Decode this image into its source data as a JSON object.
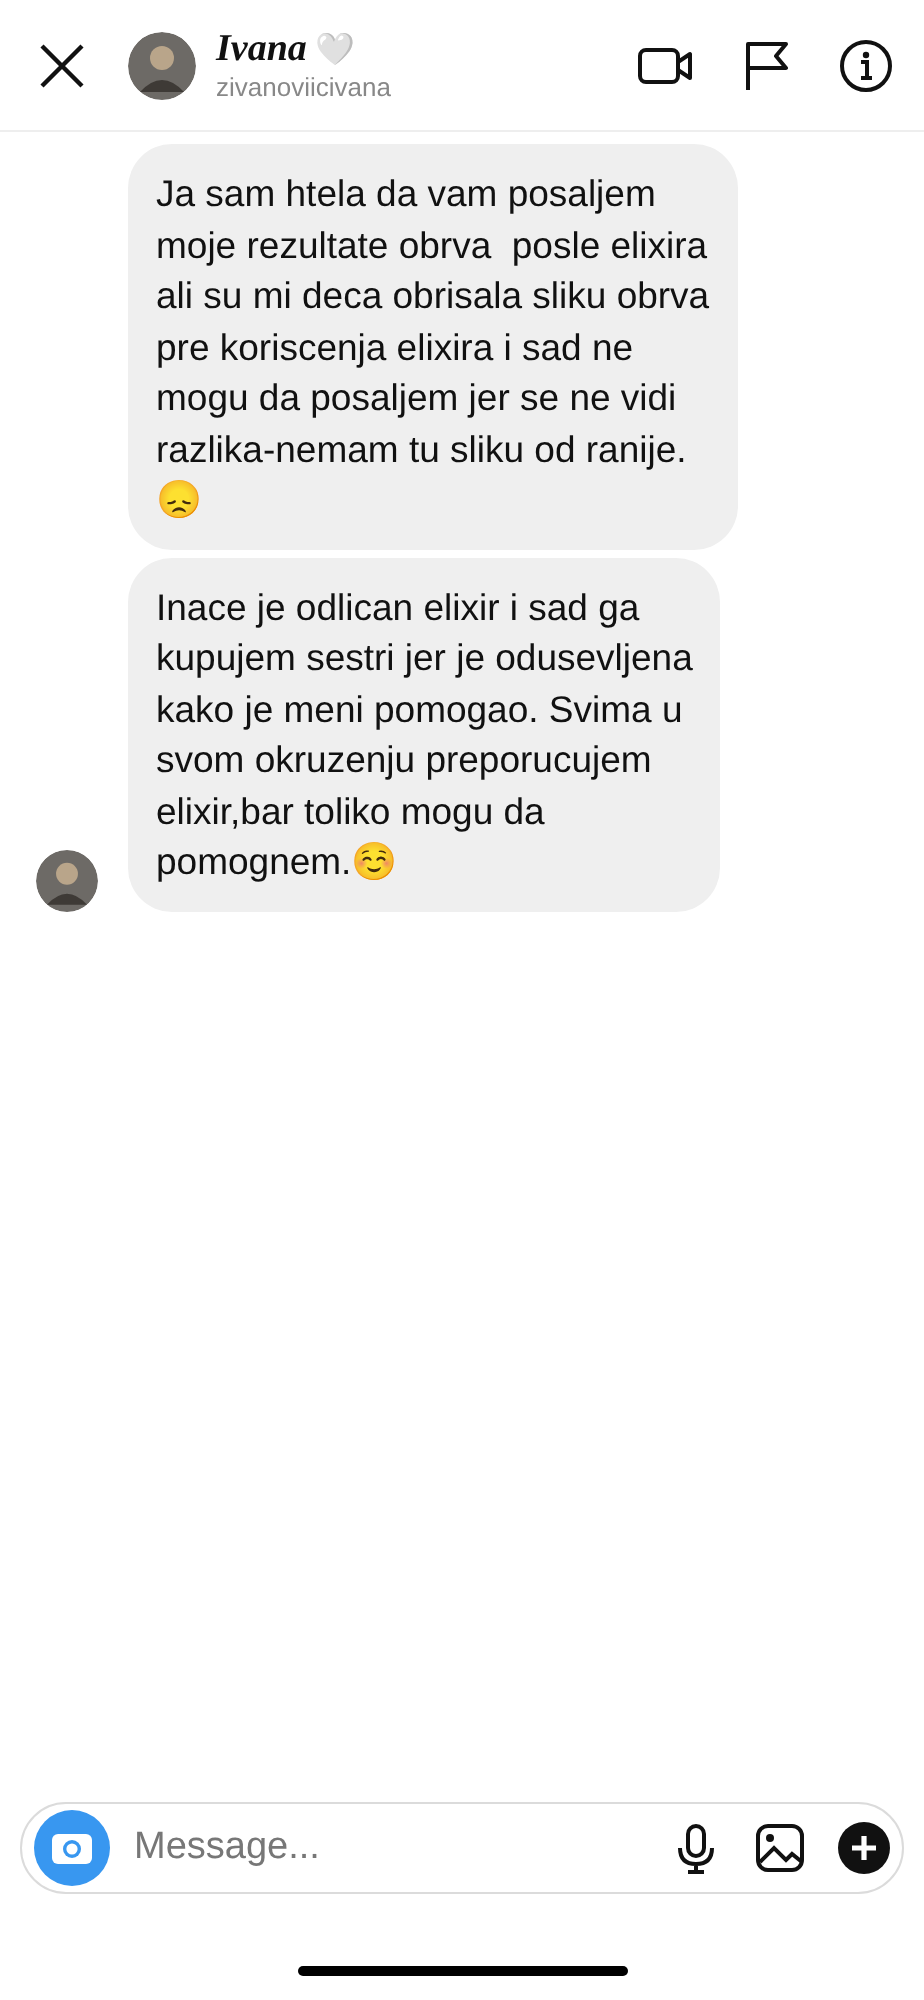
{
  "header": {
    "name": "Ivana",
    "badge": "🤍",
    "username": "zivanoviicivana"
  },
  "messages": [
    {
      "text": "Ja sam htela da vam posaljem\nmoje rezultate obrva  posle elixira\nali su mi deca obrisala sliku obrva\npre koriscenja elixira i sad ne\nmogu da posaljem jer se ne vidi\nrazlika-nemam tu sliku od ranije.\n😞",
      "show_avatar": false
    },
    {
      "text": "Inace je odlican elixir i sad ga\nkupujem sestri jer je odusevljena\nkako je meni pomogao. Svima u\nsvom okruzenju preporucujem\nelixir,bar toliko mogu da\npomognem.☺️",
      "show_avatar": true
    }
  ],
  "composer": {
    "placeholder": "Message..."
  }
}
